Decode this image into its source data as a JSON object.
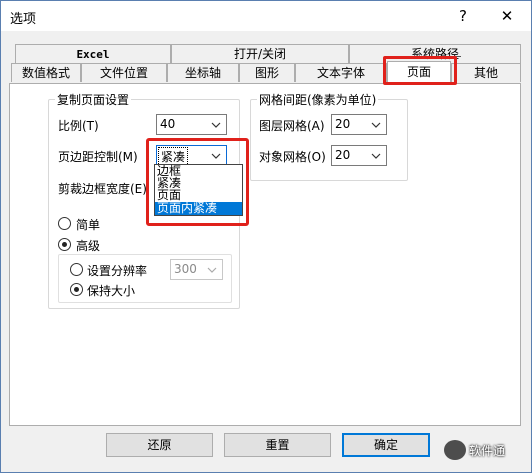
{
  "window": {
    "title": "选项",
    "help_symbol": "?",
    "close_symbol": "✕"
  },
  "tabs": {
    "row1": [
      {
        "label": "Excel"
      },
      {
        "label": "打开/关闭"
      },
      {
        "label": "系统路径"
      }
    ],
    "row2": [
      {
        "label": "数值格式"
      },
      {
        "label": "文件位置"
      },
      {
        "label": "坐标轴"
      },
      {
        "label": "图形"
      },
      {
        "label": "文本字体"
      },
      {
        "label": "页面",
        "active": true
      },
      {
        "label": "其他"
      }
    ]
  },
  "copy_page": {
    "legend": "复制页面设置",
    "ratio_label": "比例(T)",
    "ratio_value": "40",
    "margin_label": "页边距控制(M)",
    "margin_value": "紧凑",
    "margin_options": [
      "边框",
      "紧凑",
      "页面",
      "页面内紧凑"
    ],
    "margin_highlighted_option": "页面内紧凑",
    "crop_label": "剪裁边框宽度(E)",
    "radio_simple": "简单",
    "radio_advanced": "高级",
    "radio_resolution": "设置分辨率",
    "resolution_value": "300",
    "radio_keep_size": "保持大小",
    "selected_mode": "高级",
    "selected_sub": "保持大小"
  },
  "grid_spacing": {
    "legend": "网格间距(像素为单位)",
    "layer_label": "图层网格(A)",
    "layer_value": "20",
    "object_label": "对象网格(O)",
    "object_value": "20"
  },
  "buttons": {
    "reset": "还原",
    "reset_default": "重置",
    "ok": "确定"
  },
  "watermark": {
    "text": "软件通"
  },
  "colors": {
    "highlight": "#e0211b",
    "selection": "#0078d7",
    "default_button_border": "#0078d7"
  }
}
